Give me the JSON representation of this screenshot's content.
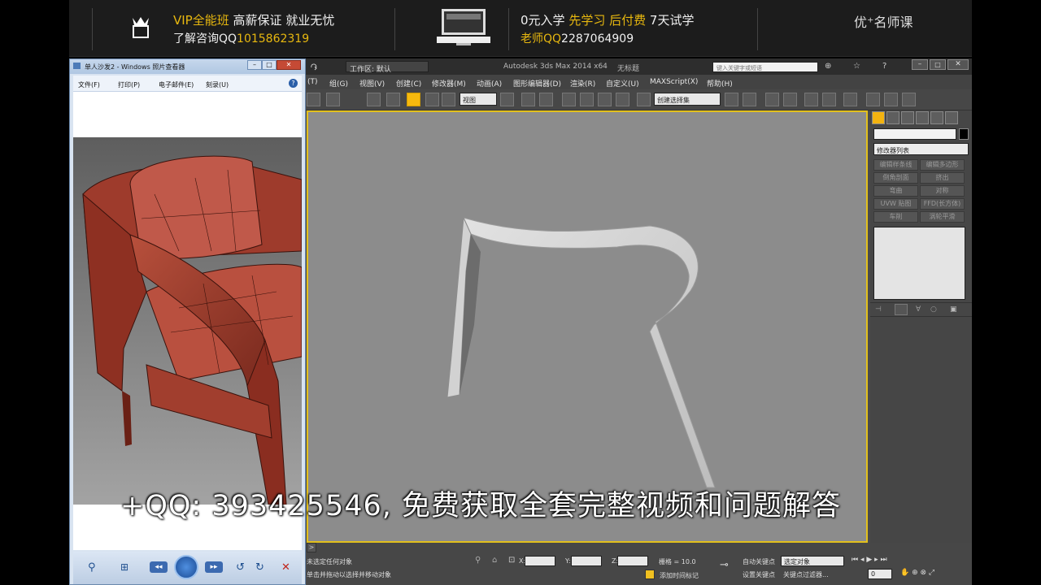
{
  "banner": {
    "left_line1_a": "VIP全能班",
    "left_line1_b": "高薪保证",
    "left_line1_c": "就业无忧",
    "left_line2_a": "了解咨询QQ",
    "left_line2_b": "1015862319",
    "right_line1_a": "0元入学",
    "right_line1_b": "先学习",
    "right_line1_c": "后付费",
    "right_line1_d": "7天试学",
    "right_line2_a": "老师QQ",
    "right_line2_b": "2287064909",
    "brand": "优⁺名师课",
    "colors": {
      "gold": "#e8b80f",
      "background": "#1c1c1c"
    }
  },
  "max": {
    "workspace_label": "工作区: 默认",
    "title": "Autodesk 3ds Max  2014 x64",
    "doc_name": "无标题",
    "search_placeholder": "键入关键字或短语",
    "menu": [
      "(T)",
      "组(G)",
      "视图(V)",
      "创建(C)",
      "修改器(M)",
      "动画(A)",
      "图形编辑器(D)",
      "渲染(R)",
      "自定义(U)",
      "MAXScript(X)",
      "帮助(H)"
    ],
    "view_dropdown": "视图",
    "selection_set": "创建选择集",
    "modifier_list": "修改器列表",
    "modifier_buttons": [
      "编辑样条线",
      "编辑多边形",
      "倒角剖面",
      "挤出",
      "弯曲",
      "对称",
      "UVW 贴图",
      "FFD(长方体)",
      "车削",
      "涡轮平滑"
    ],
    "status": {
      "selected": "未选定任何对象",
      "hint": "单击并拖动以选择并移动对象",
      "x_label": "X:",
      "y_label": "Y:",
      "z_label": "Z:",
      "grid": "栅格 = 10.0",
      "auto_key": "自动关键点",
      "selected_obj": "选定对象",
      "set_key": "设置关键点",
      "key_filter": "关键点过滤器...",
      "add_time_tag": "添加时间标记",
      "frame": "0"
    },
    "accent_color": "#f3b310"
  },
  "photo_viewer": {
    "title": "单人沙发2 - Windows 照片查看器",
    "menu": [
      "文件(F)",
      "打印(P)",
      "电子邮件(E)",
      "刻录(U)"
    ],
    "help": "?"
  },
  "subtitle": "+QQ: 393425546, 免费获取全套完整视频和问题解答"
}
